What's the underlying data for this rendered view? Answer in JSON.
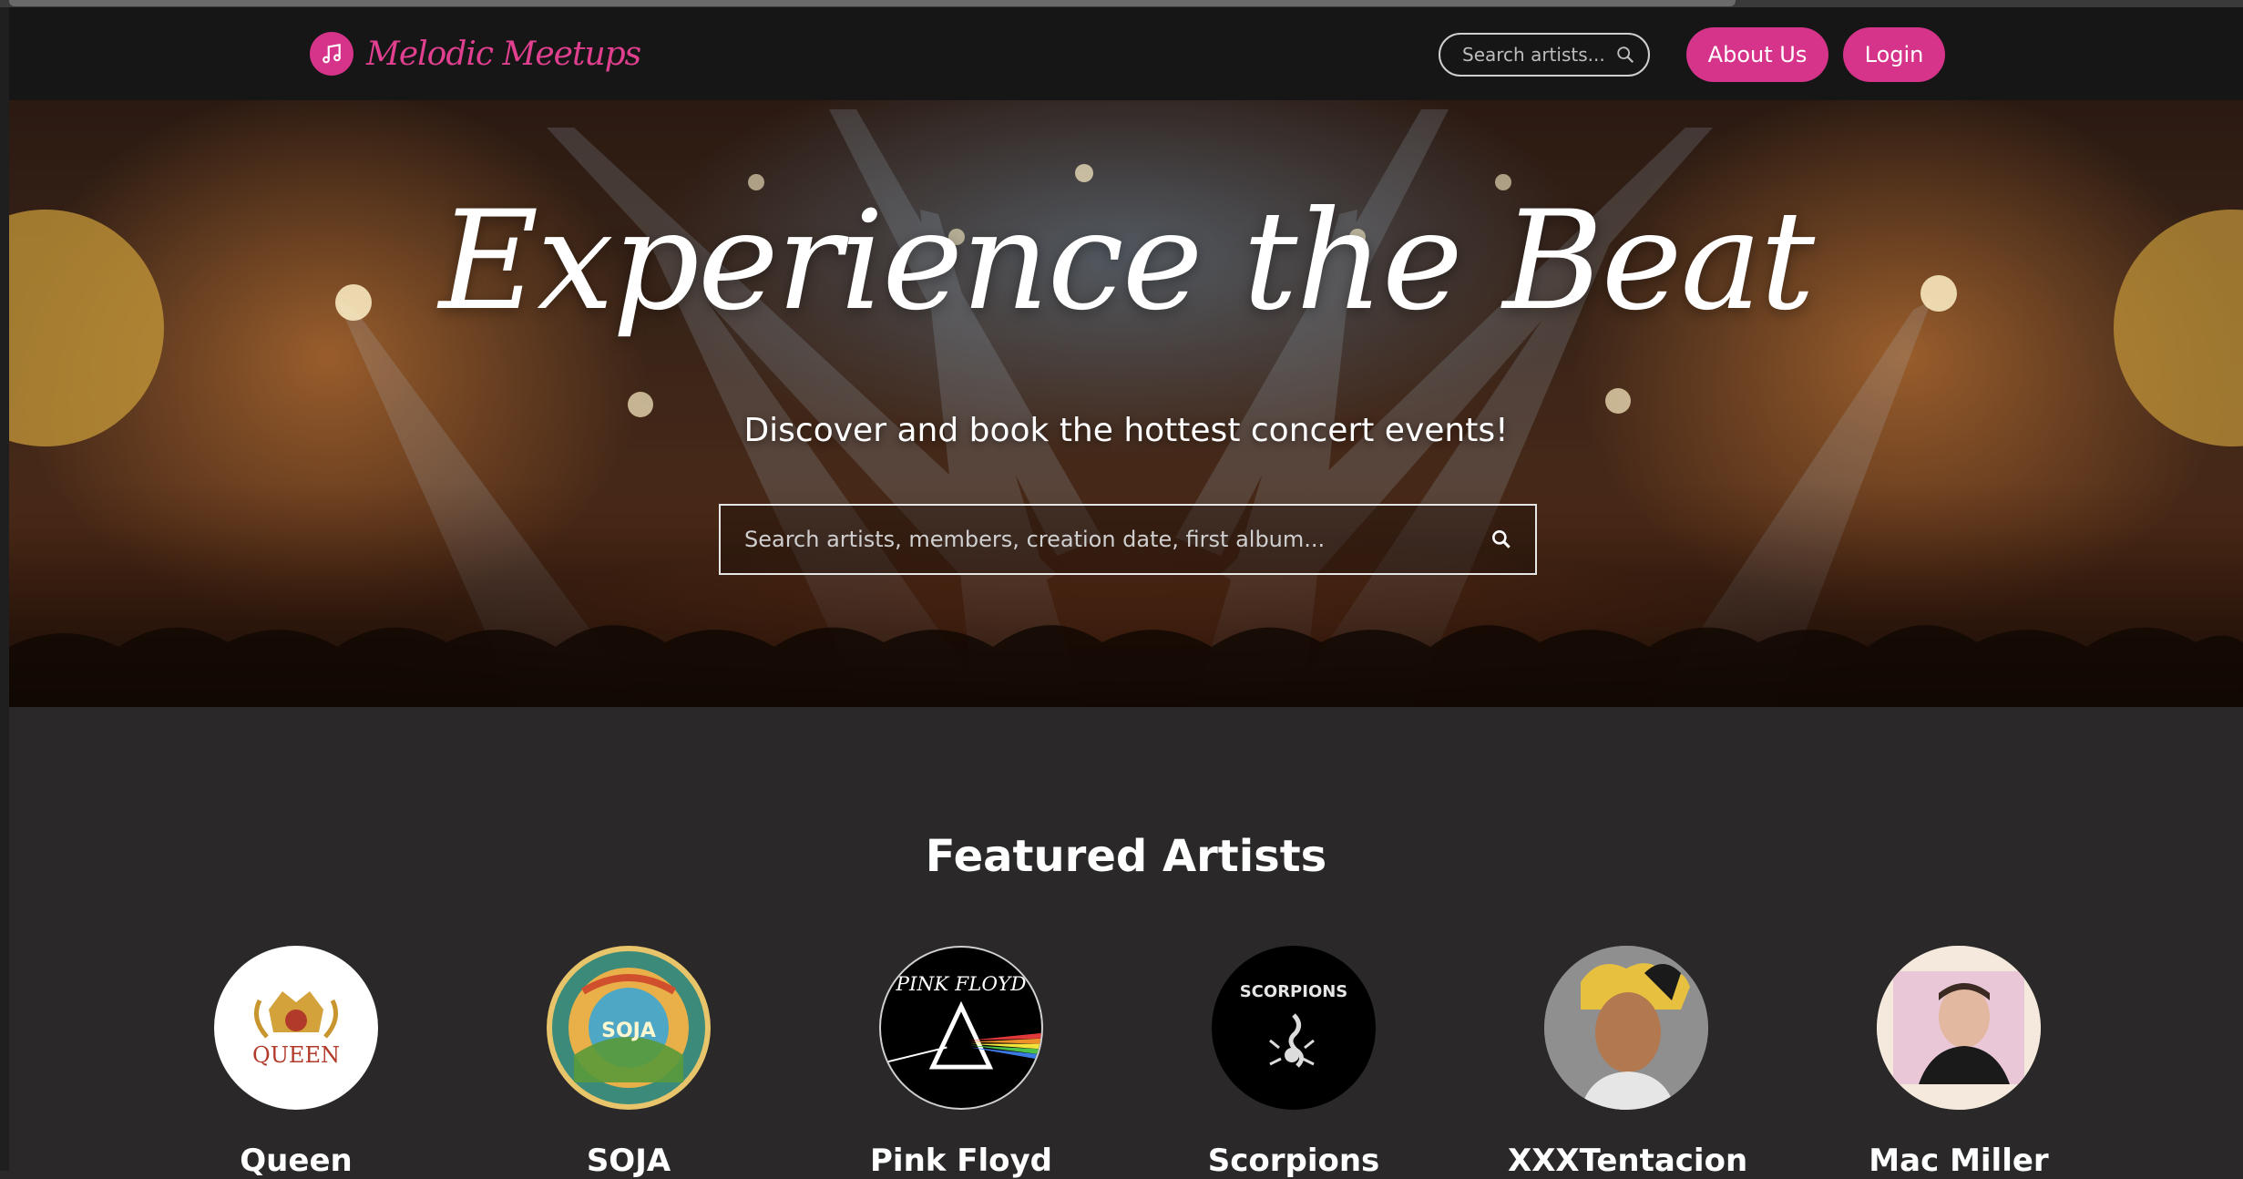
{
  "brand": {
    "name": "Melodic Meetups",
    "accent": "#d6338a"
  },
  "nav": {
    "search_placeholder": "Search artists...",
    "about_label": "About Us",
    "login_label": "Login"
  },
  "hero": {
    "title": "Experience the Beat",
    "subtitle": "Discover and book the hottest concert events!",
    "search_placeholder": "Search artists, members, creation date, first album..."
  },
  "featured": {
    "title": "Featured Artists",
    "artists": [
      {
        "name": "Queen"
      },
      {
        "name": "SOJA"
      },
      {
        "name": "Pink Floyd"
      },
      {
        "name": "Scorpions"
      },
      {
        "name": "XXXTentacion"
      },
      {
        "name": "Mac Miller"
      }
    ]
  },
  "logo_texts": {
    "queen": "QUEEN",
    "soja": "SOJA",
    "pink_floyd": "PINK FLOYD",
    "scorpions": "SCORPIONS"
  }
}
